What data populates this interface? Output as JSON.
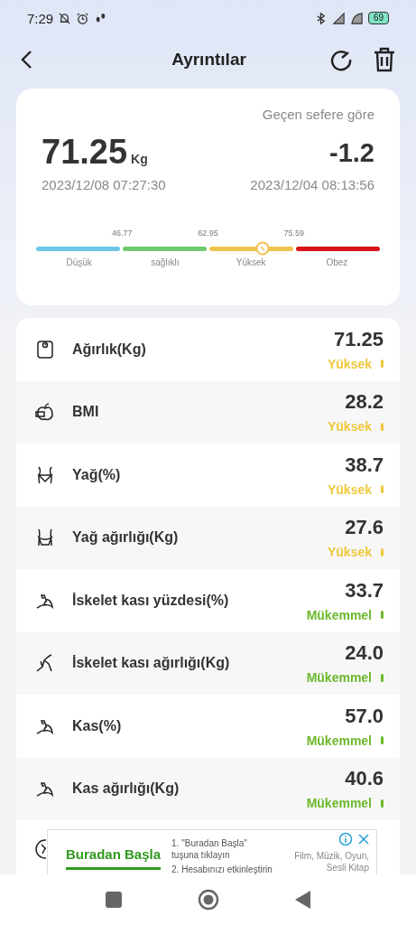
{
  "status_bar": {
    "time": "7:29",
    "battery": "69"
  },
  "header": {
    "title": "Ayrıntılar"
  },
  "summary": {
    "comparison_label": "Geçen sefere göre",
    "weight": "71.25",
    "unit": "Kg",
    "date": "2023/12/08 07:27:30",
    "change": "-1.2",
    "previous_date": "2023/12/04 08:13:56",
    "scale": {
      "level": 0.66,
      "thresholds": [
        "46.77",
        "62.95",
        "75.59"
      ],
      "segments": [
        {
          "label": "Düşük",
          "color": "#6ec6ea"
        },
        {
          "label": "sağlıklı",
          "color": "#6cc96c"
        },
        {
          "label": "Yüksek",
          "color": "#f0c24e"
        },
        {
          "label": "Obez",
          "color": "#d9141b"
        }
      ]
    }
  },
  "metrics": [
    {
      "kind": "weight",
      "name": "Ağırlık(Kg)",
      "value": "71.25",
      "status": "Yüksek",
      "color": "#eec83c"
    },
    {
      "kind": "bmi",
      "name": "BMI",
      "value": "28.2",
      "status": "Yüksek",
      "color": "#eec83c"
    },
    {
      "kind": "fat",
      "name": "Yağ(%)",
      "value": "38.7",
      "status": "Yüksek",
      "color": "#eec83c"
    },
    {
      "kind": "fatmass",
      "name": "Yağ ağırlığı(Kg)",
      "value": "27.6",
      "status": "Yüksek",
      "color": "#eec83c"
    },
    {
      "kind": "muscle",
      "name": "İskelet kası yüzdesi(%)",
      "value": "33.7",
      "status": "Mükemmel",
      "color": "#6bb82a"
    },
    {
      "kind": "skeletal",
      "name": "İskelet kası ağırlığı(Kg)",
      "value": "24.0",
      "status": "Mükemmel",
      "color": "#6bb82a"
    },
    {
      "kind": "muscle",
      "name": "Kas(%)",
      "value": "57.0",
      "status": "Mükemmel",
      "color": "#6bb82a"
    },
    {
      "kind": "muscle",
      "name": "Kas ağırlığı(Kg)",
      "value": "40.6",
      "status": "Mükemmel",
      "color": "#6bb82a"
    }
  ],
  "ad": {
    "title": "Buradan Başla",
    "steps": [
      "1. \"Buradan Başla\" tuşuna tıklayın",
      "2. Hesabınızı etkinleştirin"
    ],
    "tagline": "Film, Müzik, Oyun, Sesli Kitap"
  }
}
